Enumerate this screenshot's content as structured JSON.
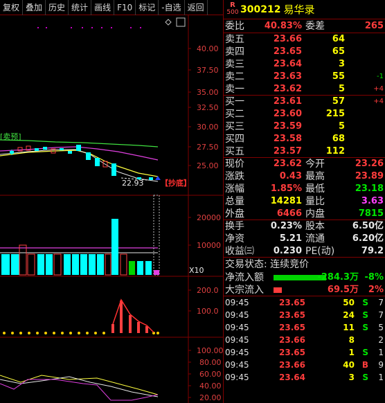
{
  "toolbar": {
    "buttons": [
      "复权",
      "叠加",
      "历史",
      "统计",
      "画线",
      "F10",
      "标记",
      "-自选",
      "返回"
    ]
  },
  "chart": {
    "price_axis": [
      "40.00",
      "37.50",
      "35.00",
      "32.50",
      "30.00",
      "27.50",
      "25.00"
    ],
    "low_price_label": "22.93",
    "signal_label": "【抄底】",
    "volume_axis": [
      "20000",
      "10000"
    ],
    "volume_unit": "X10",
    "indicator1_axis": [
      "200.0",
      "100.0"
    ],
    "indicator2_axis": [
      "100.00",
      "80.00",
      "60.00",
      "40.00",
      "20.00"
    ],
    "ma_label": "[卖预]"
  },
  "quote": {
    "rank_badge": "R",
    "rank_num": "500",
    "code": "300212",
    "name": "易华录",
    "weibi_label": "委比",
    "weibi_value": "40.83%",
    "weicha_label": "委差",
    "weicha_value": "265",
    "sells": [
      {
        "label": "卖五",
        "price": "23.66",
        "vol": "64",
        "chg": ""
      },
      {
        "label": "卖四",
        "price": "23.65",
        "vol": "65",
        "chg": ""
      },
      {
        "label": "卖三",
        "price": "23.64",
        "vol": "3",
        "chg": ""
      },
      {
        "label": "卖二",
        "price": "23.63",
        "vol": "55",
        "chg": "-1"
      },
      {
        "label": "卖一",
        "price": "23.62",
        "vol": "5",
        "chg": "+4"
      }
    ],
    "buys": [
      {
        "label": "买一",
        "price": "23.61",
        "vol": "57",
        "chg": "+4"
      },
      {
        "label": "买二",
        "price": "23.60",
        "vol": "215",
        "chg": ""
      },
      {
        "label": "买三",
        "price": "23.59",
        "vol": "5",
        "chg": ""
      },
      {
        "label": "买四",
        "price": "23.58",
        "vol": "68",
        "chg": ""
      },
      {
        "label": "买五",
        "price": "23.57",
        "vol": "112",
        "chg": ""
      }
    ],
    "stats": [
      {
        "l1": "现价",
        "v1": "23.62",
        "l2": "今开",
        "v2": "23.26"
      },
      {
        "l1": "涨跌",
        "v1": "0.43",
        "l2": "最高",
        "v2": "23.89"
      },
      {
        "l1": "涨幅",
        "v1": "1.85%",
        "l2": "最低",
        "v2": "23.18"
      },
      {
        "l1": "总量",
        "v1": "14281",
        "l2": "量比",
        "v2": "3.63"
      },
      {
        "l1": "外盘",
        "v1": "6466",
        "l2": "内盘",
        "v2": "7815"
      }
    ],
    "stats2": [
      {
        "l1": "换手",
        "v1": "0.23%",
        "l2": "股本",
        "v2": "6.50亿"
      },
      {
        "l1": "净资",
        "v1": "5.21",
        "l2": "流通",
        "v2": "6.20亿"
      },
      {
        "l1": "收益㈢",
        "v1": "0.230",
        "l2": "PE(动)",
        "v2": "79.2"
      }
    ],
    "trade_status": "交易状态: 连续竞价",
    "net_flow_label": "净流入额",
    "net_flow_value": "-284.3万",
    "net_flow_pct": "-8%",
    "block_label": "大宗流入",
    "block_value": "69.5万",
    "block_pct": "2%",
    "ticks": [
      {
        "time": "09:45",
        "price": "23.65",
        "vol": "50",
        "dir": "S",
        "num": "7"
      },
      {
        "time": "09:45",
        "price": "23.65",
        "vol": "24",
        "dir": "S",
        "num": "7"
      },
      {
        "time": "09:45",
        "price": "23.65",
        "vol": "11",
        "dir": "S",
        "num": "5"
      },
      {
        "time": "09:45",
        "price": "23.66",
        "vol": "8",
        "dir": "",
        "num": "2"
      },
      {
        "time": "09:45",
        "price": "23.65",
        "vol": "1",
        "dir": "S",
        "num": "1"
      },
      {
        "time": "09:45",
        "price": "23.66",
        "vol": "40",
        "dir": "B",
        "num": "9"
      },
      {
        "time": "09:45",
        "price": "23.64",
        "vol": "3",
        "dir": "S",
        "num": "1"
      }
    ]
  }
}
